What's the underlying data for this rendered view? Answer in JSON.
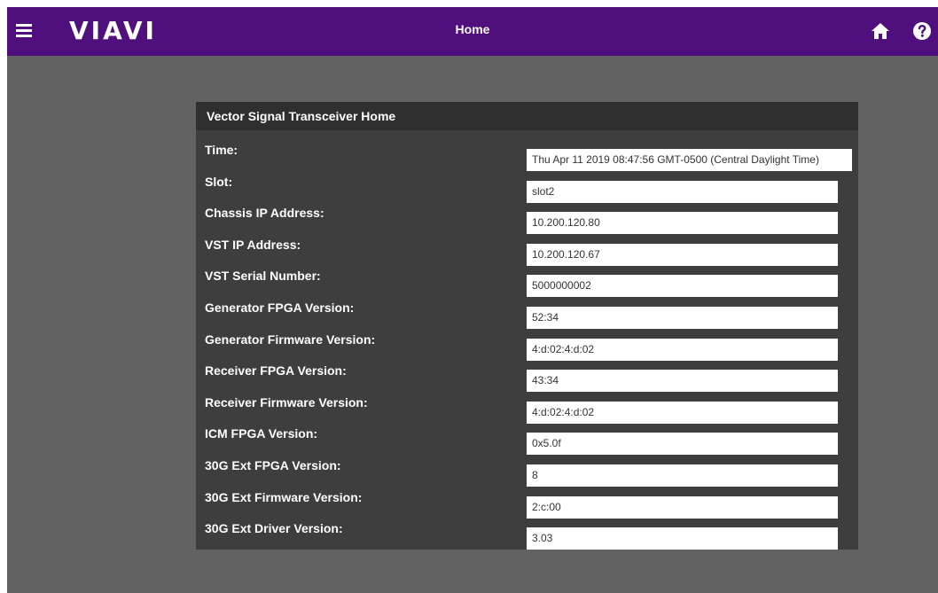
{
  "topbar": {
    "logo": "VIAVI",
    "title": "Home",
    "bg_color": "#4f0f7c"
  },
  "icons": {
    "menu": "menu-icon",
    "home": "home-icon",
    "help": "help-icon"
  },
  "panel": {
    "title": "Vector Signal Transceiver Home",
    "rows": [
      {
        "label": "Time:",
        "value": "Thu Apr 11 2019 08:47:56 GMT-0500 (Central Daylight Time)"
      },
      {
        "label": "Slot:",
        "value": "slot2"
      },
      {
        "label": "Chassis IP Address:",
        "value": "10.200.120.80"
      },
      {
        "label": "VST IP Address:",
        "value": "10.200.120.67"
      },
      {
        "label": "VST Serial Number:",
        "value": "5000000002"
      },
      {
        "label": "Generator FPGA Version:",
        "value": "52:34"
      },
      {
        "label": "Generator Firmware Version:",
        "value": "4:d:02:4:d:02"
      },
      {
        "label": "Receiver FPGA Version:",
        "value": "43:34"
      },
      {
        "label": "Receiver Firmware Version:",
        "value": "4:d:02:4:d:02"
      },
      {
        "label": "ICM FPGA Version:",
        "value": "0x5.0f"
      },
      {
        "label": "30G Ext FPGA Version:",
        "value": "8"
      },
      {
        "label": "30G Ext Firmware Version:",
        "value": "2:c:00"
      },
      {
        "label": "30G Ext Driver Version:",
        "value": "3.03"
      }
    ]
  }
}
